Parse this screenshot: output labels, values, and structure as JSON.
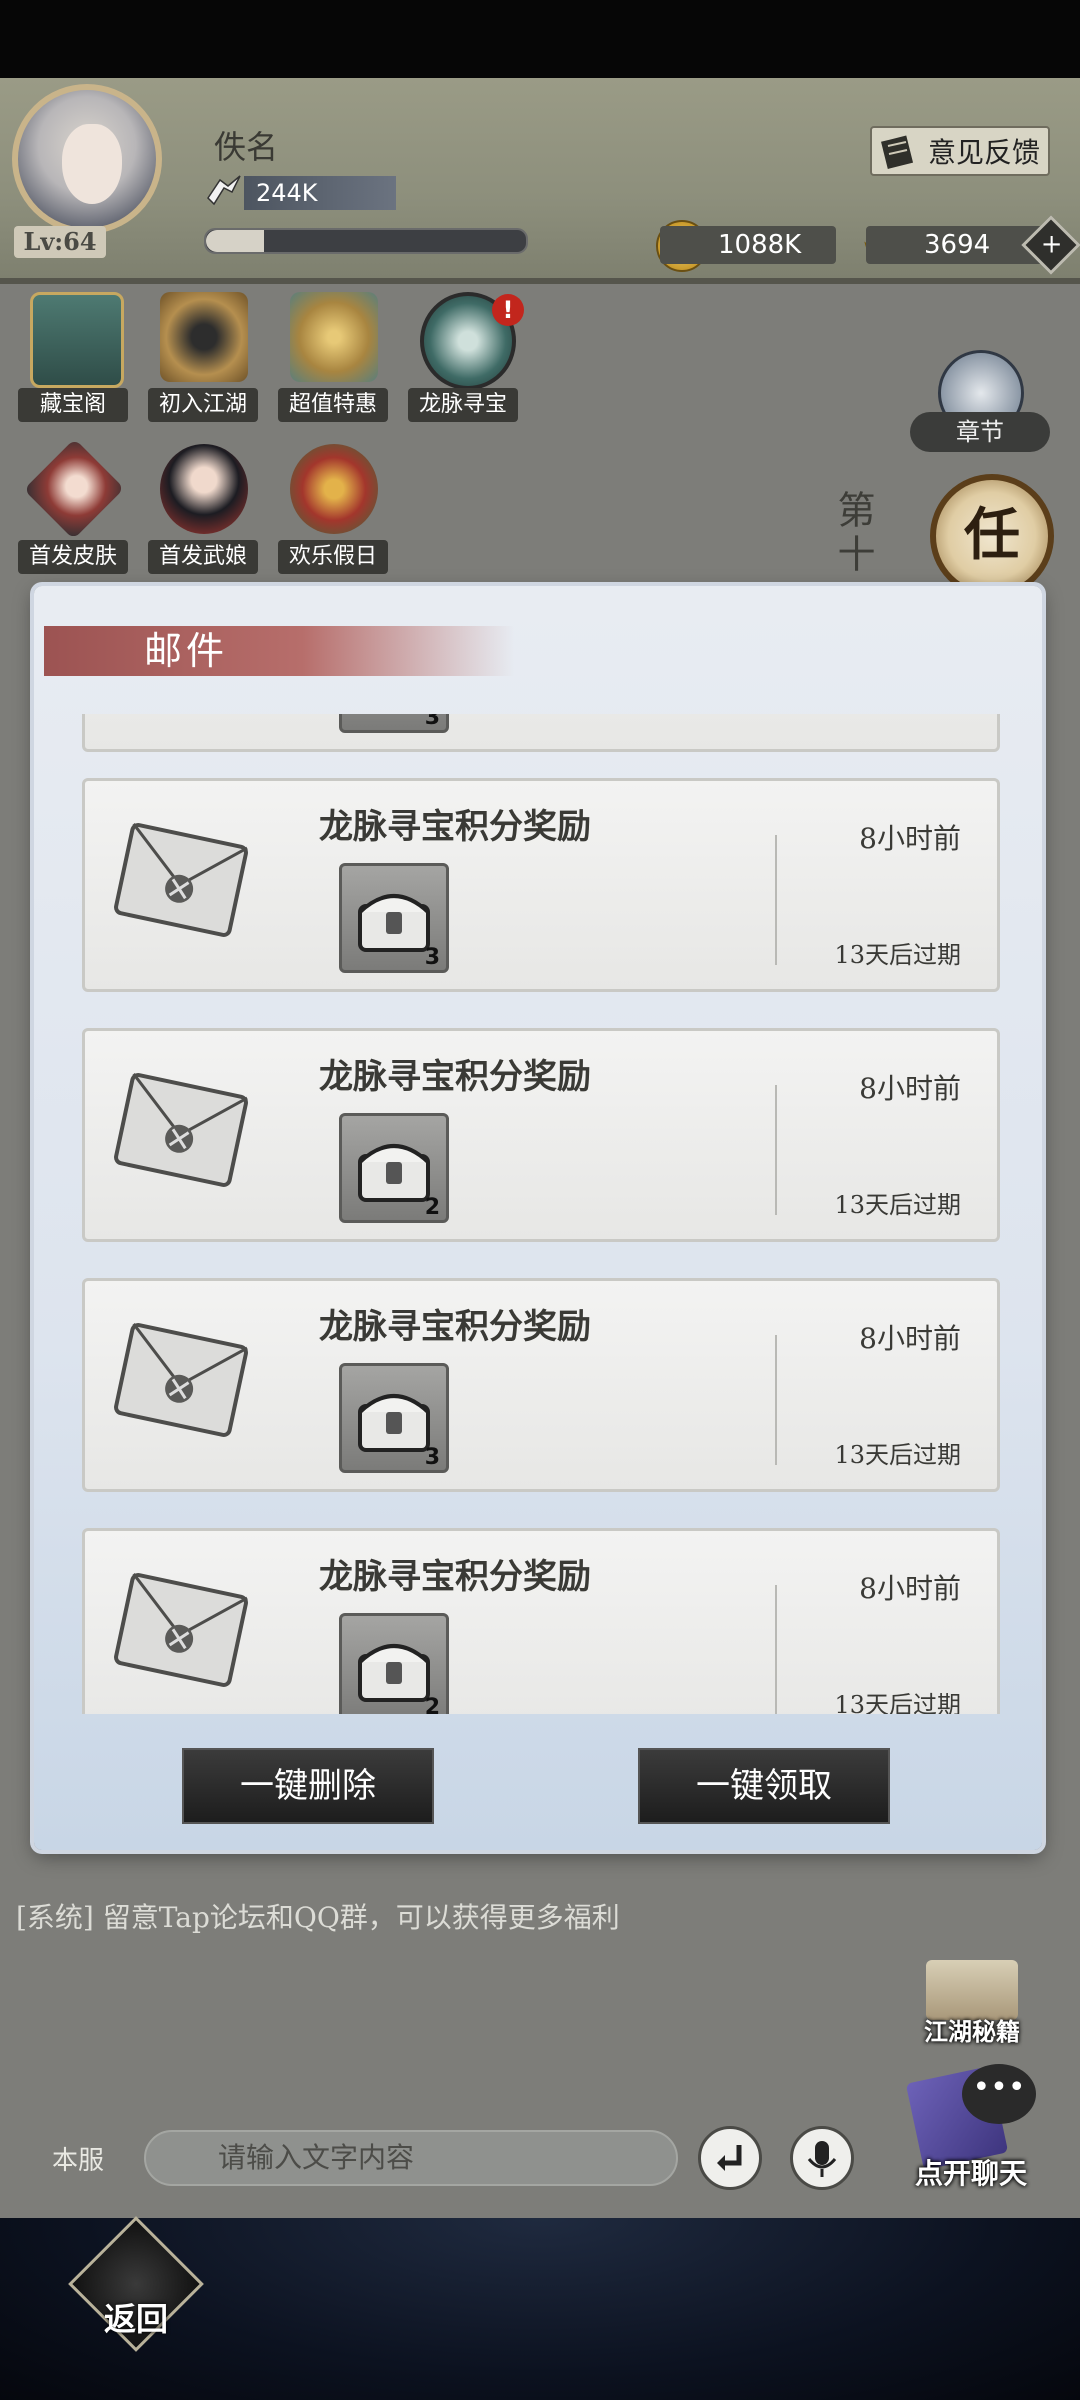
{
  "player": {
    "name": "佚名",
    "level": "Lv:64",
    "power": "244K",
    "exp_fraction": 0.18
  },
  "header": {
    "feedback_label": "意见反馈",
    "coins": "1088K",
    "ingots": "3694",
    "plus_symbol": "+"
  },
  "activities": [
    {
      "label": "藏宝阁",
      "icon": "treasure-pavilion-icon"
    },
    {
      "label": "初入江湖",
      "icon": "jianghu-start-icon"
    },
    {
      "label": "超值特惠",
      "icon": "value-deal-icon"
    },
    {
      "label": "龙脉寻宝",
      "icon": "dragon-compass-icon",
      "badge": "!"
    },
    {
      "label": "首发皮肤",
      "icon": "skin-icon"
    },
    {
      "label": "首发武娘",
      "icon": "heroine-icon"
    },
    {
      "label": "欢乐假日",
      "icon": "holiday-icon"
    }
  ],
  "side": {
    "chapter_label": "章节",
    "task_glyph": "任",
    "side_text": "第十"
  },
  "mail": {
    "title": "邮件",
    "items": [
      {
        "title": "龙脉寻宝积分奖励",
        "time": "8小时前",
        "expire": "13天后过期",
        "count": "3"
      },
      {
        "title": "龙脉寻宝积分奖励",
        "time": "8小时前",
        "expire": "13天后过期",
        "count": "2"
      },
      {
        "title": "龙脉寻宝积分奖励",
        "time": "8小时前",
        "expire": "13天后过期",
        "count": "3"
      },
      {
        "title": "龙脉寻宝积分奖励",
        "time": "8小时前",
        "expire": "13天后过期",
        "count": "2"
      }
    ],
    "partial_count": "3",
    "delete_all": "一键删除",
    "claim_all": "一键领取"
  },
  "chat": {
    "system_message": "[系统] 留意Tap论坛和QQ群，可以获得更多福利",
    "server_label": "本服",
    "input_placeholder": "请输入文字内容",
    "secrets_label": "江湖秘籍",
    "open_chat_label": "点开聊天",
    "bubble_glyph": "•••"
  },
  "nav": {
    "back_label": "返回"
  }
}
